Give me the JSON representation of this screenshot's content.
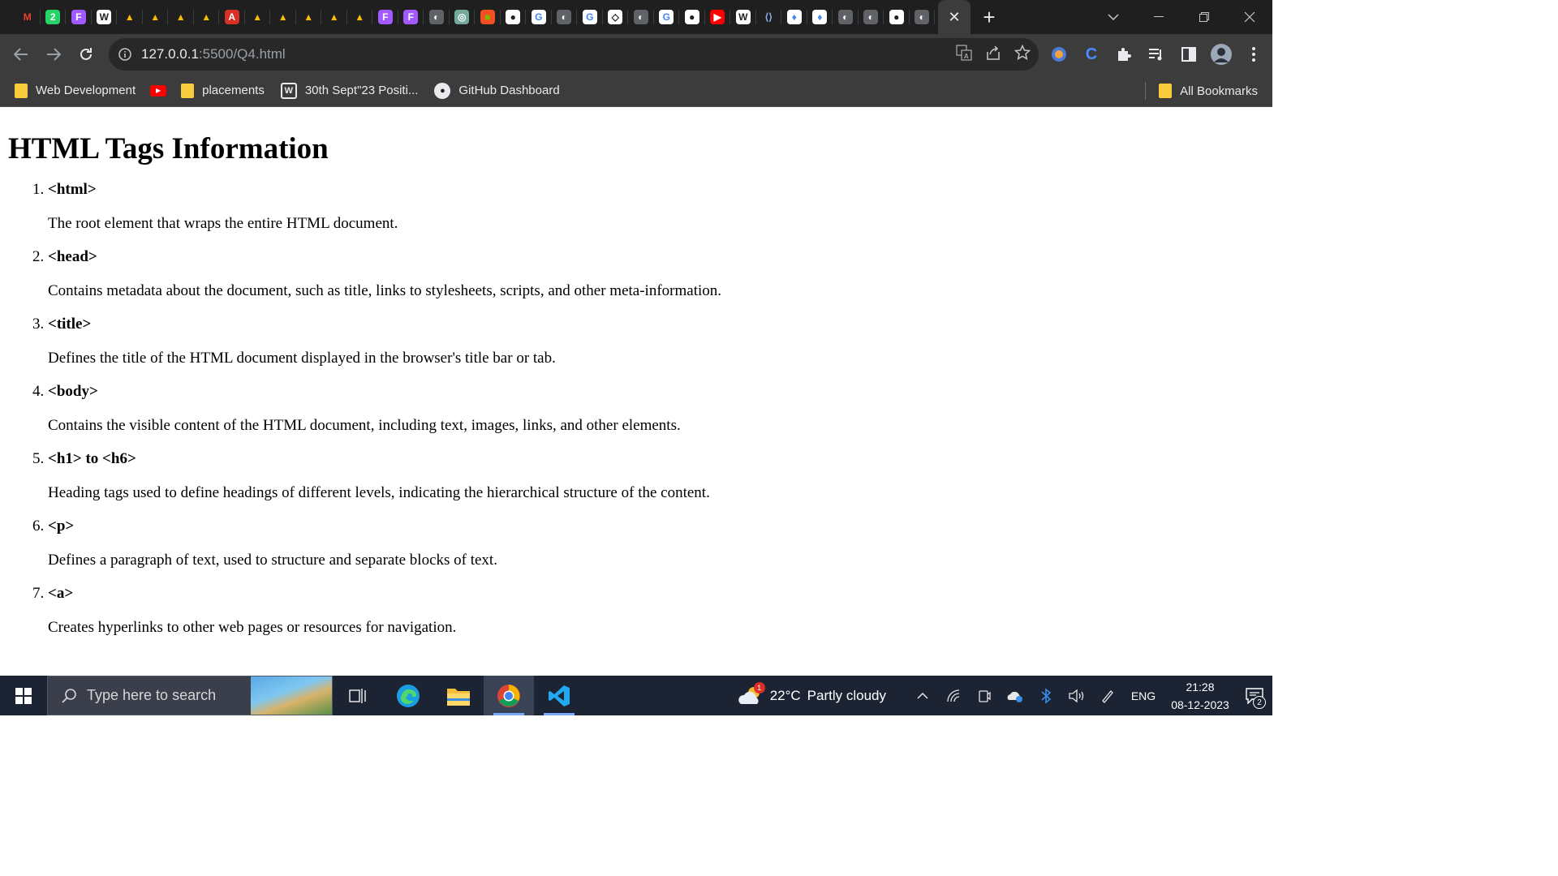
{
  "browser": {
    "tab_favicons": [
      {
        "name": "gmail-icon",
        "glyph": "M",
        "bg": "#1f1f1f",
        "fg": "#ea4335"
      },
      {
        "name": "whatsapp-icon",
        "glyph": "2",
        "bg": "#25d366",
        "fg": "#ffffff"
      },
      {
        "name": "figma-icon",
        "glyph": "F",
        "bg": "#a259ff",
        "fg": "#ffffff"
      },
      {
        "name": "wordpress-icon",
        "glyph": "W",
        "bg": "#ffffff",
        "fg": "#1f1f1f"
      },
      {
        "name": "google-drive-icon",
        "glyph": "▲",
        "bg": "#1f1f1f",
        "fg": "#fbbc04"
      },
      {
        "name": "google-drive-icon",
        "glyph": "▲",
        "bg": "#1f1f1f",
        "fg": "#fbbc04"
      },
      {
        "name": "google-drive-icon",
        "glyph": "▲",
        "bg": "#1f1f1f",
        "fg": "#fbbc04"
      },
      {
        "name": "google-drive-icon",
        "glyph": "▲",
        "bg": "#1f1f1f",
        "fg": "#fbbc04"
      },
      {
        "name": "pdf-icon",
        "glyph": "A",
        "bg": "#d93025",
        "fg": "#ffffff"
      },
      {
        "name": "google-drive-icon",
        "glyph": "▲",
        "bg": "#1f1f1f",
        "fg": "#fbbc04"
      },
      {
        "name": "google-drive-icon",
        "glyph": "▲",
        "bg": "#1f1f1f",
        "fg": "#fbbc04"
      },
      {
        "name": "google-drive-icon",
        "glyph": "▲",
        "bg": "#1f1f1f",
        "fg": "#fbbc04"
      },
      {
        "name": "google-drive-icon",
        "glyph": "▲",
        "bg": "#1f1f1f",
        "fg": "#fbbc04"
      },
      {
        "name": "google-drive-icon",
        "glyph": "▲",
        "bg": "#1f1f1f",
        "fg": "#fbbc04"
      },
      {
        "name": "figma-icon",
        "glyph": "F",
        "bg": "#a259ff",
        "fg": "#ffffff"
      },
      {
        "name": "figma-icon",
        "glyph": "F",
        "bg": "#a259ff",
        "fg": "#ffffff"
      },
      {
        "name": "globe-icon",
        "glyph": "◐",
        "bg": "#5f6368",
        "fg": "#ffffff"
      },
      {
        "name": "chatgpt-icon",
        "glyph": "◎",
        "bg": "#74aa9c",
        "fg": "#ffffff"
      },
      {
        "name": "microsoft-icon",
        "glyph": "■",
        "bg": "#f25022",
        "fg": "#7fba00"
      },
      {
        "name": "github-icon",
        "glyph": "●",
        "bg": "#ffffff",
        "fg": "#1f1f1f"
      },
      {
        "name": "google-icon",
        "glyph": "G",
        "bg": "#ffffff",
        "fg": "#4285f4"
      },
      {
        "name": "globe-icon",
        "glyph": "◐",
        "bg": "#5f6368",
        "fg": "#ffffff"
      },
      {
        "name": "google-icon",
        "glyph": "G",
        "bg": "#ffffff",
        "fg": "#4285f4"
      },
      {
        "name": "codepen-icon",
        "glyph": "◇",
        "bg": "#ffffff",
        "fg": "#1f1f1f"
      },
      {
        "name": "globe-icon",
        "glyph": "◐",
        "bg": "#5f6368",
        "fg": "#ffffff"
      },
      {
        "name": "google-icon",
        "glyph": "G",
        "bg": "#ffffff",
        "fg": "#4285f4"
      },
      {
        "name": "github-icon",
        "glyph": "●",
        "bg": "#ffffff",
        "fg": "#1f1f1f"
      },
      {
        "name": "youtube-icon",
        "glyph": "▶",
        "bg": "#ff0000",
        "fg": "#ffffff"
      },
      {
        "name": "wordpress-icon",
        "glyph": "W",
        "bg": "#ffffff",
        "fg": "#1f1f1f"
      },
      {
        "name": "code-icon",
        "glyph": "⟨⟩",
        "bg": "#1f1f1f",
        "fg": "#8ab4f8"
      },
      {
        "name": "flame-icon",
        "glyph": "♦",
        "bg": "#ffffff",
        "fg": "#4285f4"
      },
      {
        "name": "flame-icon",
        "glyph": "♦",
        "bg": "#ffffff",
        "fg": "#4285f4"
      },
      {
        "name": "globe-icon",
        "glyph": "◐",
        "bg": "#5f6368",
        "fg": "#ffffff"
      },
      {
        "name": "globe-icon",
        "glyph": "◐",
        "bg": "#5f6368",
        "fg": "#ffffff"
      },
      {
        "name": "github-icon",
        "glyph": "●",
        "bg": "#ffffff",
        "fg": "#1f1f1f"
      },
      {
        "name": "globe-icon",
        "glyph": "◐",
        "bg": "#5f6368",
        "fg": "#ffffff"
      }
    ],
    "active_tab_close": "✕",
    "new_tab": "+",
    "url_host": "127.0.0.1",
    "url_path": ":5500/Q4.html",
    "bookmarks": [
      {
        "label": "Web Development",
        "icon": "folder-icon"
      },
      {
        "label": "",
        "icon": "youtube-icon"
      },
      {
        "label": "placements",
        "icon": "folder-icon"
      },
      {
        "label": "30th Sept\"23 Positi...",
        "icon": "wordpress-icon"
      },
      {
        "label": "GitHub Dashboard",
        "icon": "github-icon"
      }
    ],
    "all_bookmarks": "All Bookmarks"
  },
  "page": {
    "title": "HTML Tags Information",
    "tags": [
      {
        "name": "<html>",
        "desc": "The root element that wraps the entire HTML document."
      },
      {
        "name": "<head>",
        "desc": "Contains metadata about the document, such as title, links to stylesheets, scripts, and other meta-information."
      },
      {
        "name": "<title>",
        "desc": "Defines the title of the HTML document displayed in the browser's title bar or tab."
      },
      {
        "name": "<body>",
        "desc": "Contains the visible content of the HTML document, including text, images, links, and other elements."
      },
      {
        "name": "<h1> to <h6>",
        "desc": "Heading tags used to define headings of different levels, indicating the hierarchical structure of the content."
      },
      {
        "name": "<p>",
        "desc": "Defines a paragraph of text, used to structure and separate blocks of text."
      },
      {
        "name": "<a>",
        "desc": "Creates hyperlinks to other web pages or resources for navigation."
      }
    ]
  },
  "taskbar": {
    "search_placeholder": "Type here to search",
    "weather_temp": "22°C",
    "weather_text": "Partly cloudy",
    "weather_badge": "1",
    "language": "ENG",
    "time": "21:28",
    "date": "08-12-2023",
    "notification_count": "2"
  }
}
